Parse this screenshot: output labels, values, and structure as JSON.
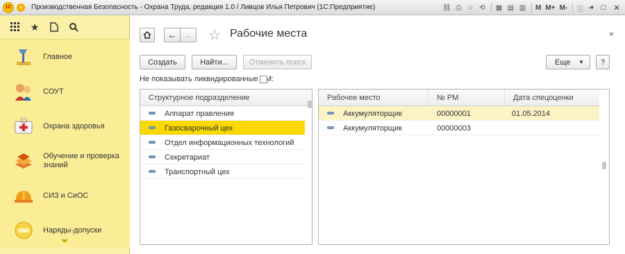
{
  "window": {
    "title": "Производственная Безопасность - Охрана Труда, редакция 1.0 / Ливцов Илья Петрович  (1С:Предприятие)",
    "logo_text": "1С",
    "toolbar_m": "M",
    "toolbar_mplus": "M+",
    "toolbar_mminus": "M-"
  },
  "sidebar": {
    "items": [
      {
        "label": "Главное",
        "icon": "desk-lamp-icon"
      },
      {
        "label": "СОУТ",
        "icon": "workers-icon"
      },
      {
        "label": "Охрана здоровья",
        "icon": "first-aid-kit-icon"
      },
      {
        "label": "Обучение и проверка знаний",
        "icon": "books-icon"
      },
      {
        "label": "СИЗ и СиОС",
        "icon": "hard-hat-icon"
      },
      {
        "label": "Наряды-допуски",
        "icon": "permit-icon"
      }
    ]
  },
  "page": {
    "title": "Рабочие места",
    "close_symbol": "×"
  },
  "toolbar": {
    "create": "Создать",
    "find": "Найти...",
    "cancel_search": "Отменить поиск",
    "more": "Еще",
    "help": "?"
  },
  "filter": {
    "hide_liquidated_label": "Не показывать ликвидированные РМ:",
    "hide_liquidated_checked": false
  },
  "departments": {
    "header": "Структурное подразделение",
    "rows": [
      "Аппарат правления",
      "Газосварочный цех",
      "Отдел информационных технологий",
      "Секретариат",
      "Транспортный цех"
    ],
    "selected_index": 1
  },
  "workplaces": {
    "headers": [
      "Рабочее место",
      "№ РМ",
      "Дата спецоценки"
    ],
    "rows": [
      {
        "name": "Аккумуляторщик",
        "number": "00000001",
        "date": "01.05.2014"
      },
      {
        "name": "Аккумуляторщик",
        "number": "00000003",
        "date": ""
      }
    ],
    "selected_index": 0
  },
  "colors": {
    "sidebar_bg": "#faf0a7",
    "selection": "#f9d900",
    "row_highlight": "#fbf3c4"
  }
}
